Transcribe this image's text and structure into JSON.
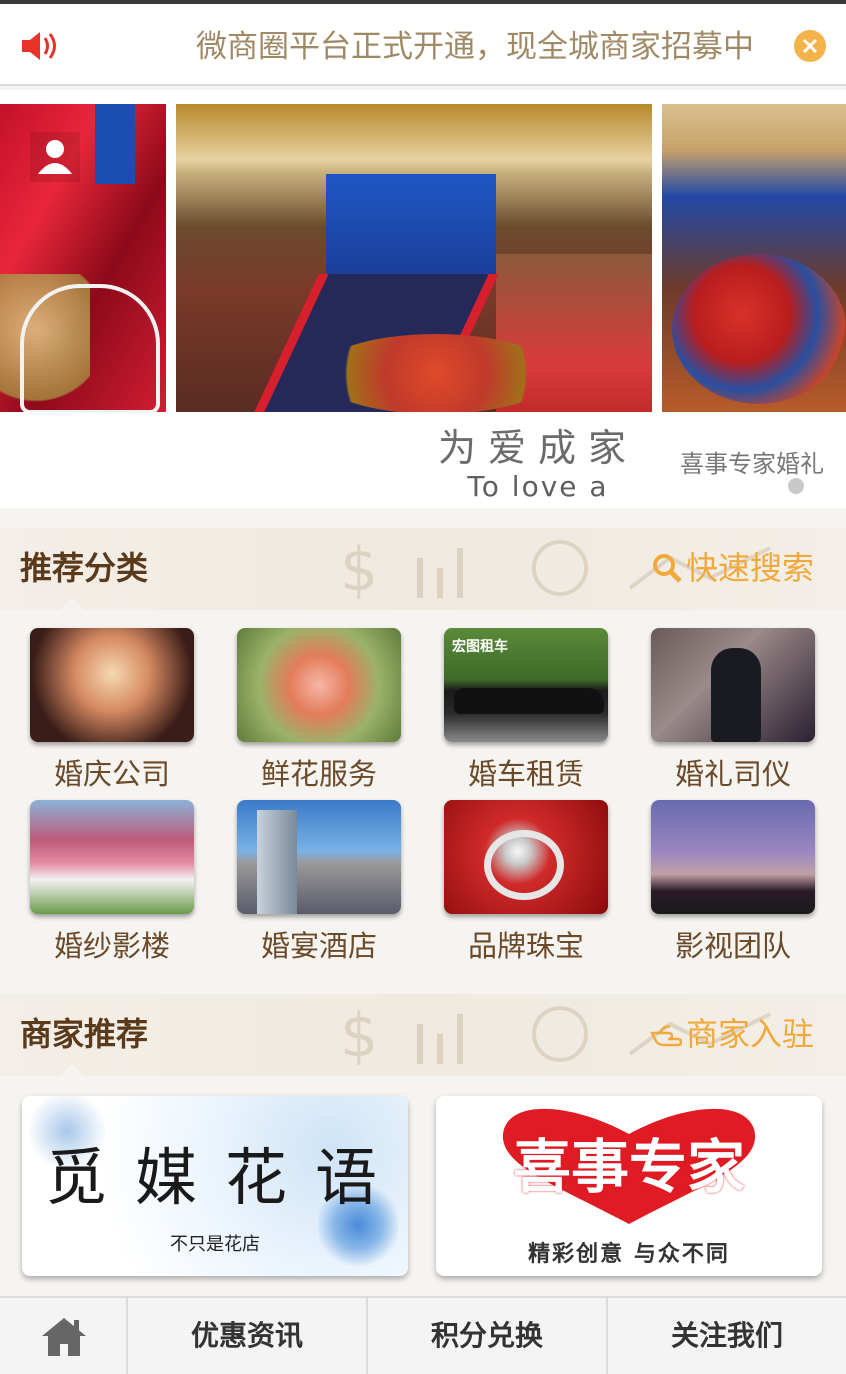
{
  "notice": {
    "text": "微商圈平台正式开通，现全城商家招募中",
    "speaker_icon": "speaker-icon",
    "close_icon": "close-icon",
    "accent": "#f3b24a"
  },
  "banner": {
    "slogan_cn": "为爱成家",
    "slogan_en": "To love a family",
    "side_text": "喜事专家婚礼",
    "avatar_icon": "user-icon"
  },
  "categories": {
    "title": "推荐分类",
    "action_label": "快速搜索",
    "action_icon": "search-icon",
    "items": [
      {
        "label": "婚庆公司"
      },
      {
        "label": "鲜花服务"
      },
      {
        "label": "婚车租赁",
        "thumb_caption": "宏图租车"
      },
      {
        "label": "婚礼司仪"
      },
      {
        "label": "婚纱影楼"
      },
      {
        "label": "婚宴酒店"
      },
      {
        "label": "品牌珠宝"
      },
      {
        "label": "影视团队"
      }
    ]
  },
  "merchants": {
    "title": "商家推荐",
    "action_label": "商家入驻",
    "action_icon": "pointing-hand-icon",
    "items": [
      {
        "name": "觅媒花语",
        "tagline": "不只是花店"
      },
      {
        "name": "喜事专家",
        "tagline": "精彩创意 与众不同"
      }
    ]
  },
  "bottom_nav": {
    "home_icon": "home-icon",
    "items": [
      {
        "label": "优惠资讯"
      },
      {
        "label": "积分兑换"
      },
      {
        "label": "关注我们"
      }
    ]
  },
  "colors": {
    "title_brown": "#5a3a1a",
    "label_brown": "#6b4a2a",
    "action_orange": "#f0a93a",
    "brand_red": "#e01b24"
  }
}
